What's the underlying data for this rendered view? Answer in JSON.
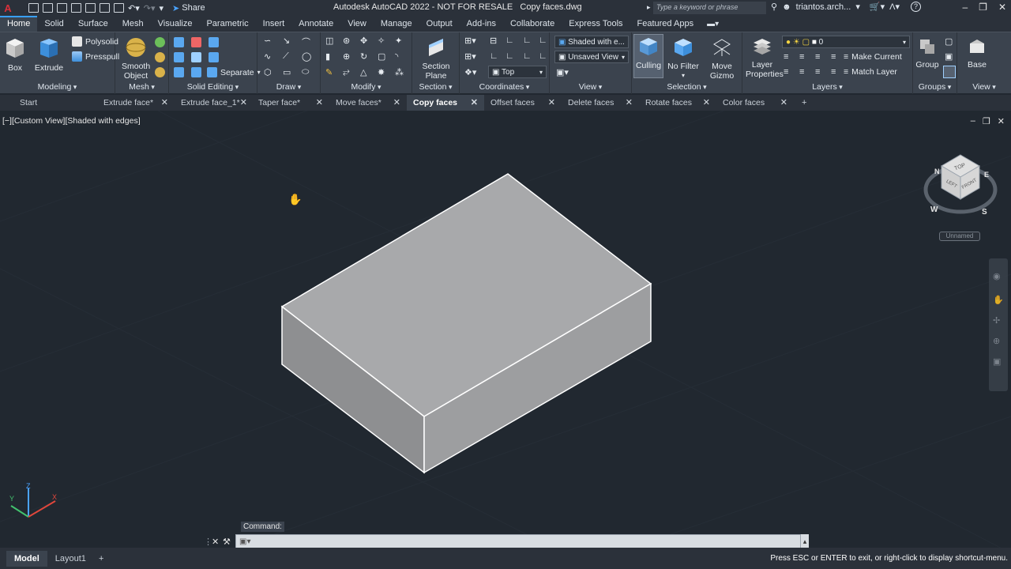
{
  "titlebar": {
    "app_letter": "A",
    "share_label": "Share",
    "title": "Autodesk AutoCAD 2022 - NOT FOR RESALE",
    "filename": "Copy faces.dwg",
    "search_placeholder": "Type a keyword or phrase",
    "user": "triantos.arch...",
    "help": "?"
  },
  "ribbon_tabs": [
    "Home",
    "Solid",
    "Surface",
    "Mesh",
    "Visualize",
    "Parametric",
    "Insert",
    "Annotate",
    "View",
    "Manage",
    "Output",
    "Add-ins",
    "Collaborate",
    "Express Tools",
    "Featured Apps"
  ],
  "ribbon": {
    "modeling": {
      "title": "Modeling",
      "box": "Box",
      "extrude": "Extrude",
      "polysolid": "Polysolid",
      "presspull": "Presspull"
    },
    "mesh": {
      "title": "Mesh",
      "smooth_object_1": "Smooth",
      "smooth_object_2": "Object"
    },
    "solid_editing": {
      "title": "Solid Editing",
      "separate": "Separate"
    },
    "draw": {
      "title": "Draw"
    },
    "modify": {
      "title": "Modify"
    },
    "section": {
      "title": "Section",
      "section_plane_1": "Section",
      "section_plane_2": "Plane"
    },
    "coordinates": {
      "title": "Coordinates",
      "ucs_value": "Top"
    },
    "view": {
      "title": "View",
      "visual_style": "Shaded with e...",
      "named_view": "Unsaved View"
    },
    "selection": {
      "title": "Selection",
      "culling": "Culling",
      "no_filter": "No Filter",
      "move_gizmo_1": "Move",
      "move_gizmo_2": "Gizmo"
    },
    "layers": {
      "title": "Layers",
      "layer_properties_1": "Layer",
      "layer_properties_2": "Properties",
      "current_layer": "0",
      "make_current": "Make Current",
      "match_layer": "Match Layer"
    },
    "groups": {
      "title": "Groups",
      "group": "Group"
    },
    "viewpanel": {
      "title": "View",
      "base": "Base"
    }
  },
  "doc_tabs": [
    "Start",
    "Extrude face*",
    "Extrude face_1*",
    "Taper face*",
    "Move faces*",
    "Copy faces",
    "Offset faces",
    "Delete faces",
    "Rotate faces",
    "Color faces"
  ],
  "viewport": {
    "label": "[−][Custom View][Shaded with edges]",
    "navcube_top": "TOP",
    "navcube_front": "FRONT",
    "navcube_left": "LEFT",
    "compass_w": "W",
    "compass_s": "S",
    "compass_e": "E",
    "compass_n": "N",
    "named": "Unnamed",
    "ucs_x": "X",
    "ucs_y": "Y",
    "ucs_z": "Z"
  },
  "command": {
    "label": "Command:"
  },
  "status": {
    "tabs": [
      "Model",
      "Layout1"
    ],
    "message": "Press ESC or ENTER to exit, or right-click to display shortcut-menu."
  },
  "colors": {
    "background": "#212830",
    "ribbon": "#3b434e",
    "accent": "#39a0ff",
    "box_top": "#a8a9ab",
    "box_left": "#8e8f91",
    "box_right": "#9d9ea0"
  }
}
